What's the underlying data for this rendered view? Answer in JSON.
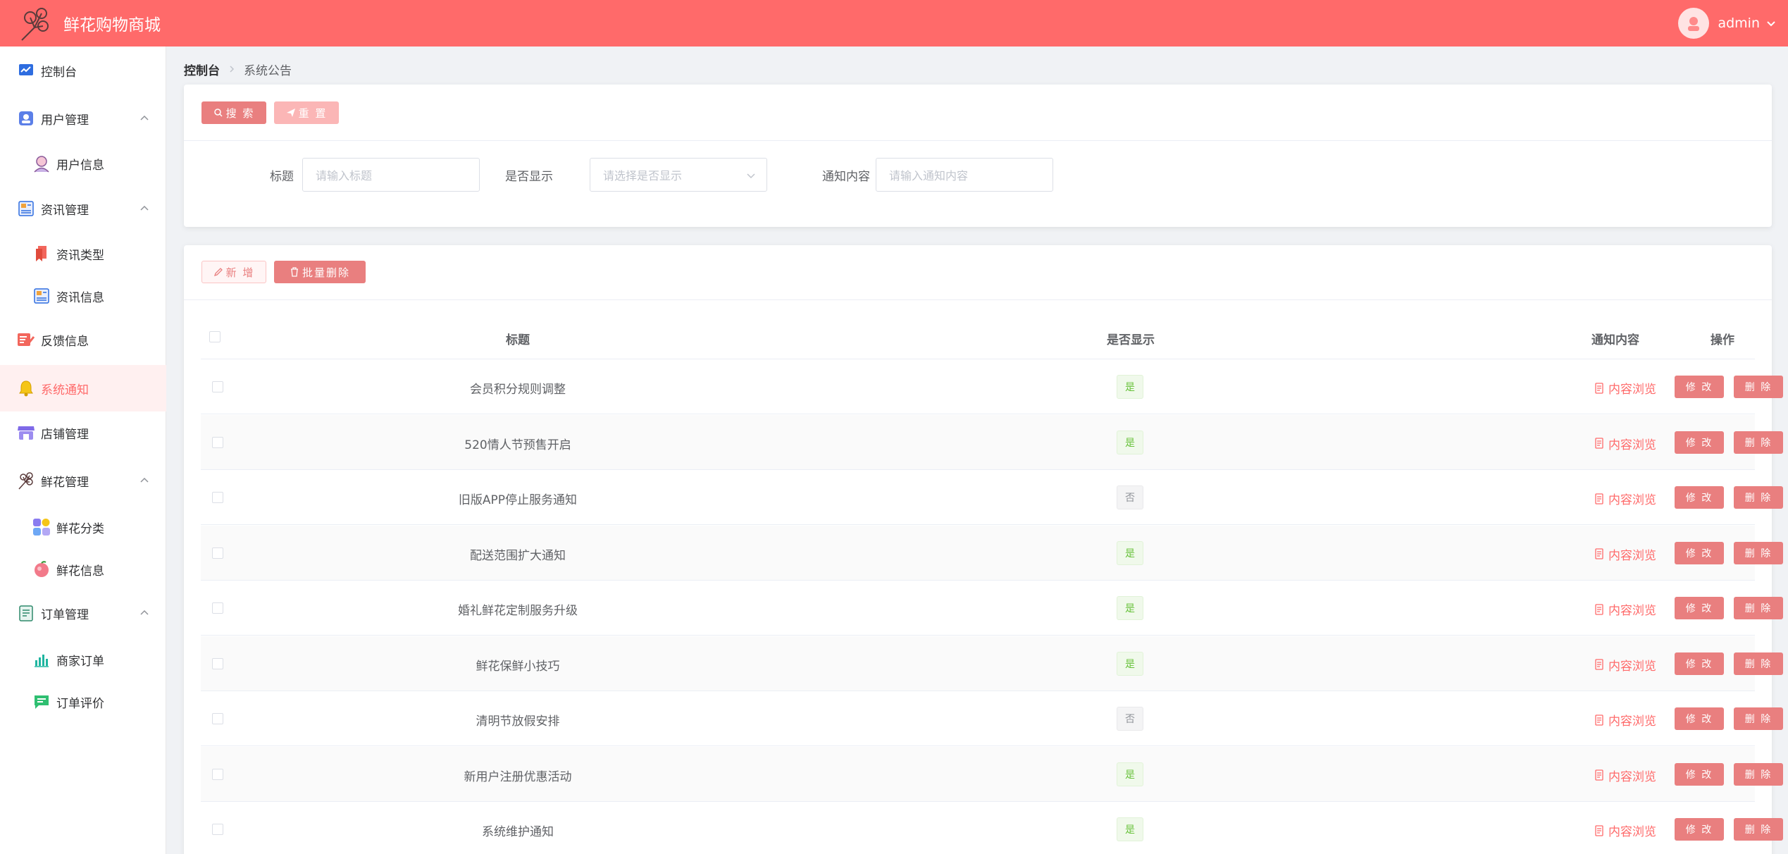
{
  "app": {
    "title": "鲜花购物商城"
  },
  "user": {
    "name": "admin"
  },
  "sidebar": {
    "items": [
      {
        "label": "控制台",
        "icon": "dashboard-icon"
      },
      {
        "label": "用户管理",
        "icon": "user-manage-icon"
      },
      {
        "label": "用户信息",
        "icon": "user-info-icon"
      },
      {
        "label": "资讯管理",
        "icon": "news-manage-icon"
      },
      {
        "label": "资讯类型",
        "icon": "bookmark-icon"
      },
      {
        "label": "资讯信息",
        "icon": "news-info-icon"
      },
      {
        "label": "反馈信息",
        "icon": "feedback-icon"
      },
      {
        "label": "系统通知",
        "icon": "bell-icon"
      },
      {
        "label": "店铺管理",
        "icon": "shop-icon"
      },
      {
        "label": "鲜花管理",
        "icon": "flower-icon"
      },
      {
        "label": "鲜花分类",
        "icon": "category-icon"
      },
      {
        "label": "鲜花信息",
        "icon": "flower-info-icon"
      },
      {
        "label": "订单管理",
        "icon": "order-icon"
      },
      {
        "label": "商家订单",
        "icon": "chart-icon"
      },
      {
        "label": "订单评价",
        "icon": "comment-icon"
      }
    ]
  },
  "breadcrumb": {
    "home": "控制台",
    "current": "系统公告"
  },
  "search": {
    "search_btn": "搜 索",
    "reset_btn": "重 置",
    "title_label": "标题",
    "title_placeholder": "请输入标题",
    "show_label": "是否显示",
    "show_placeholder": "请选择是否显示",
    "content_label": "通知内容",
    "content_placeholder": "请输入通知内容"
  },
  "toolbar": {
    "add_btn": "新 增",
    "batch_delete_btn": "批量删除"
  },
  "table": {
    "headers": {
      "title": "标题",
      "show": "是否显示",
      "content": "通知内容",
      "action": "操作"
    },
    "rows": [
      {
        "title": "会员积分规则调整",
        "show": "是",
        "content": "内容浏览",
        "edit": "修 改",
        "delete": "删 除"
      },
      {
        "title": "520情人节预售开启",
        "show": "是",
        "content": "内容浏览",
        "edit": "修 改",
        "delete": "删 除"
      },
      {
        "title": "旧版APP停止服务通知",
        "show": "否",
        "content": "内容浏览",
        "edit": "修 改",
        "delete": "删 除"
      },
      {
        "title": "配送范围扩大通知",
        "show": "是",
        "content": "内容浏览",
        "edit": "修 改",
        "delete": "删 除"
      },
      {
        "title": "婚礼鲜花定制服务升级",
        "show": "是",
        "content": "内容浏览",
        "edit": "修 改",
        "delete": "删 除"
      },
      {
        "title": "鲜花保鲜小技巧",
        "show": "是",
        "content": "内容浏览",
        "edit": "修 改",
        "delete": "删 除"
      },
      {
        "title": "清明节放假安排",
        "show": "否",
        "content": "内容浏览",
        "edit": "修 改",
        "delete": "删 除"
      },
      {
        "title": "新用户注册优惠活动",
        "show": "是",
        "content": "内容浏览",
        "edit": "修 改",
        "delete": "删 除"
      },
      {
        "title": "系统维护通知",
        "show": "是",
        "content": "内容浏览",
        "edit": "修 改",
        "delete": "删 除"
      }
    ]
  },
  "colors": {
    "primary": "#ff6a6a",
    "button": "#e97f7f",
    "yes": "#67c23a",
    "no": "#909399"
  }
}
